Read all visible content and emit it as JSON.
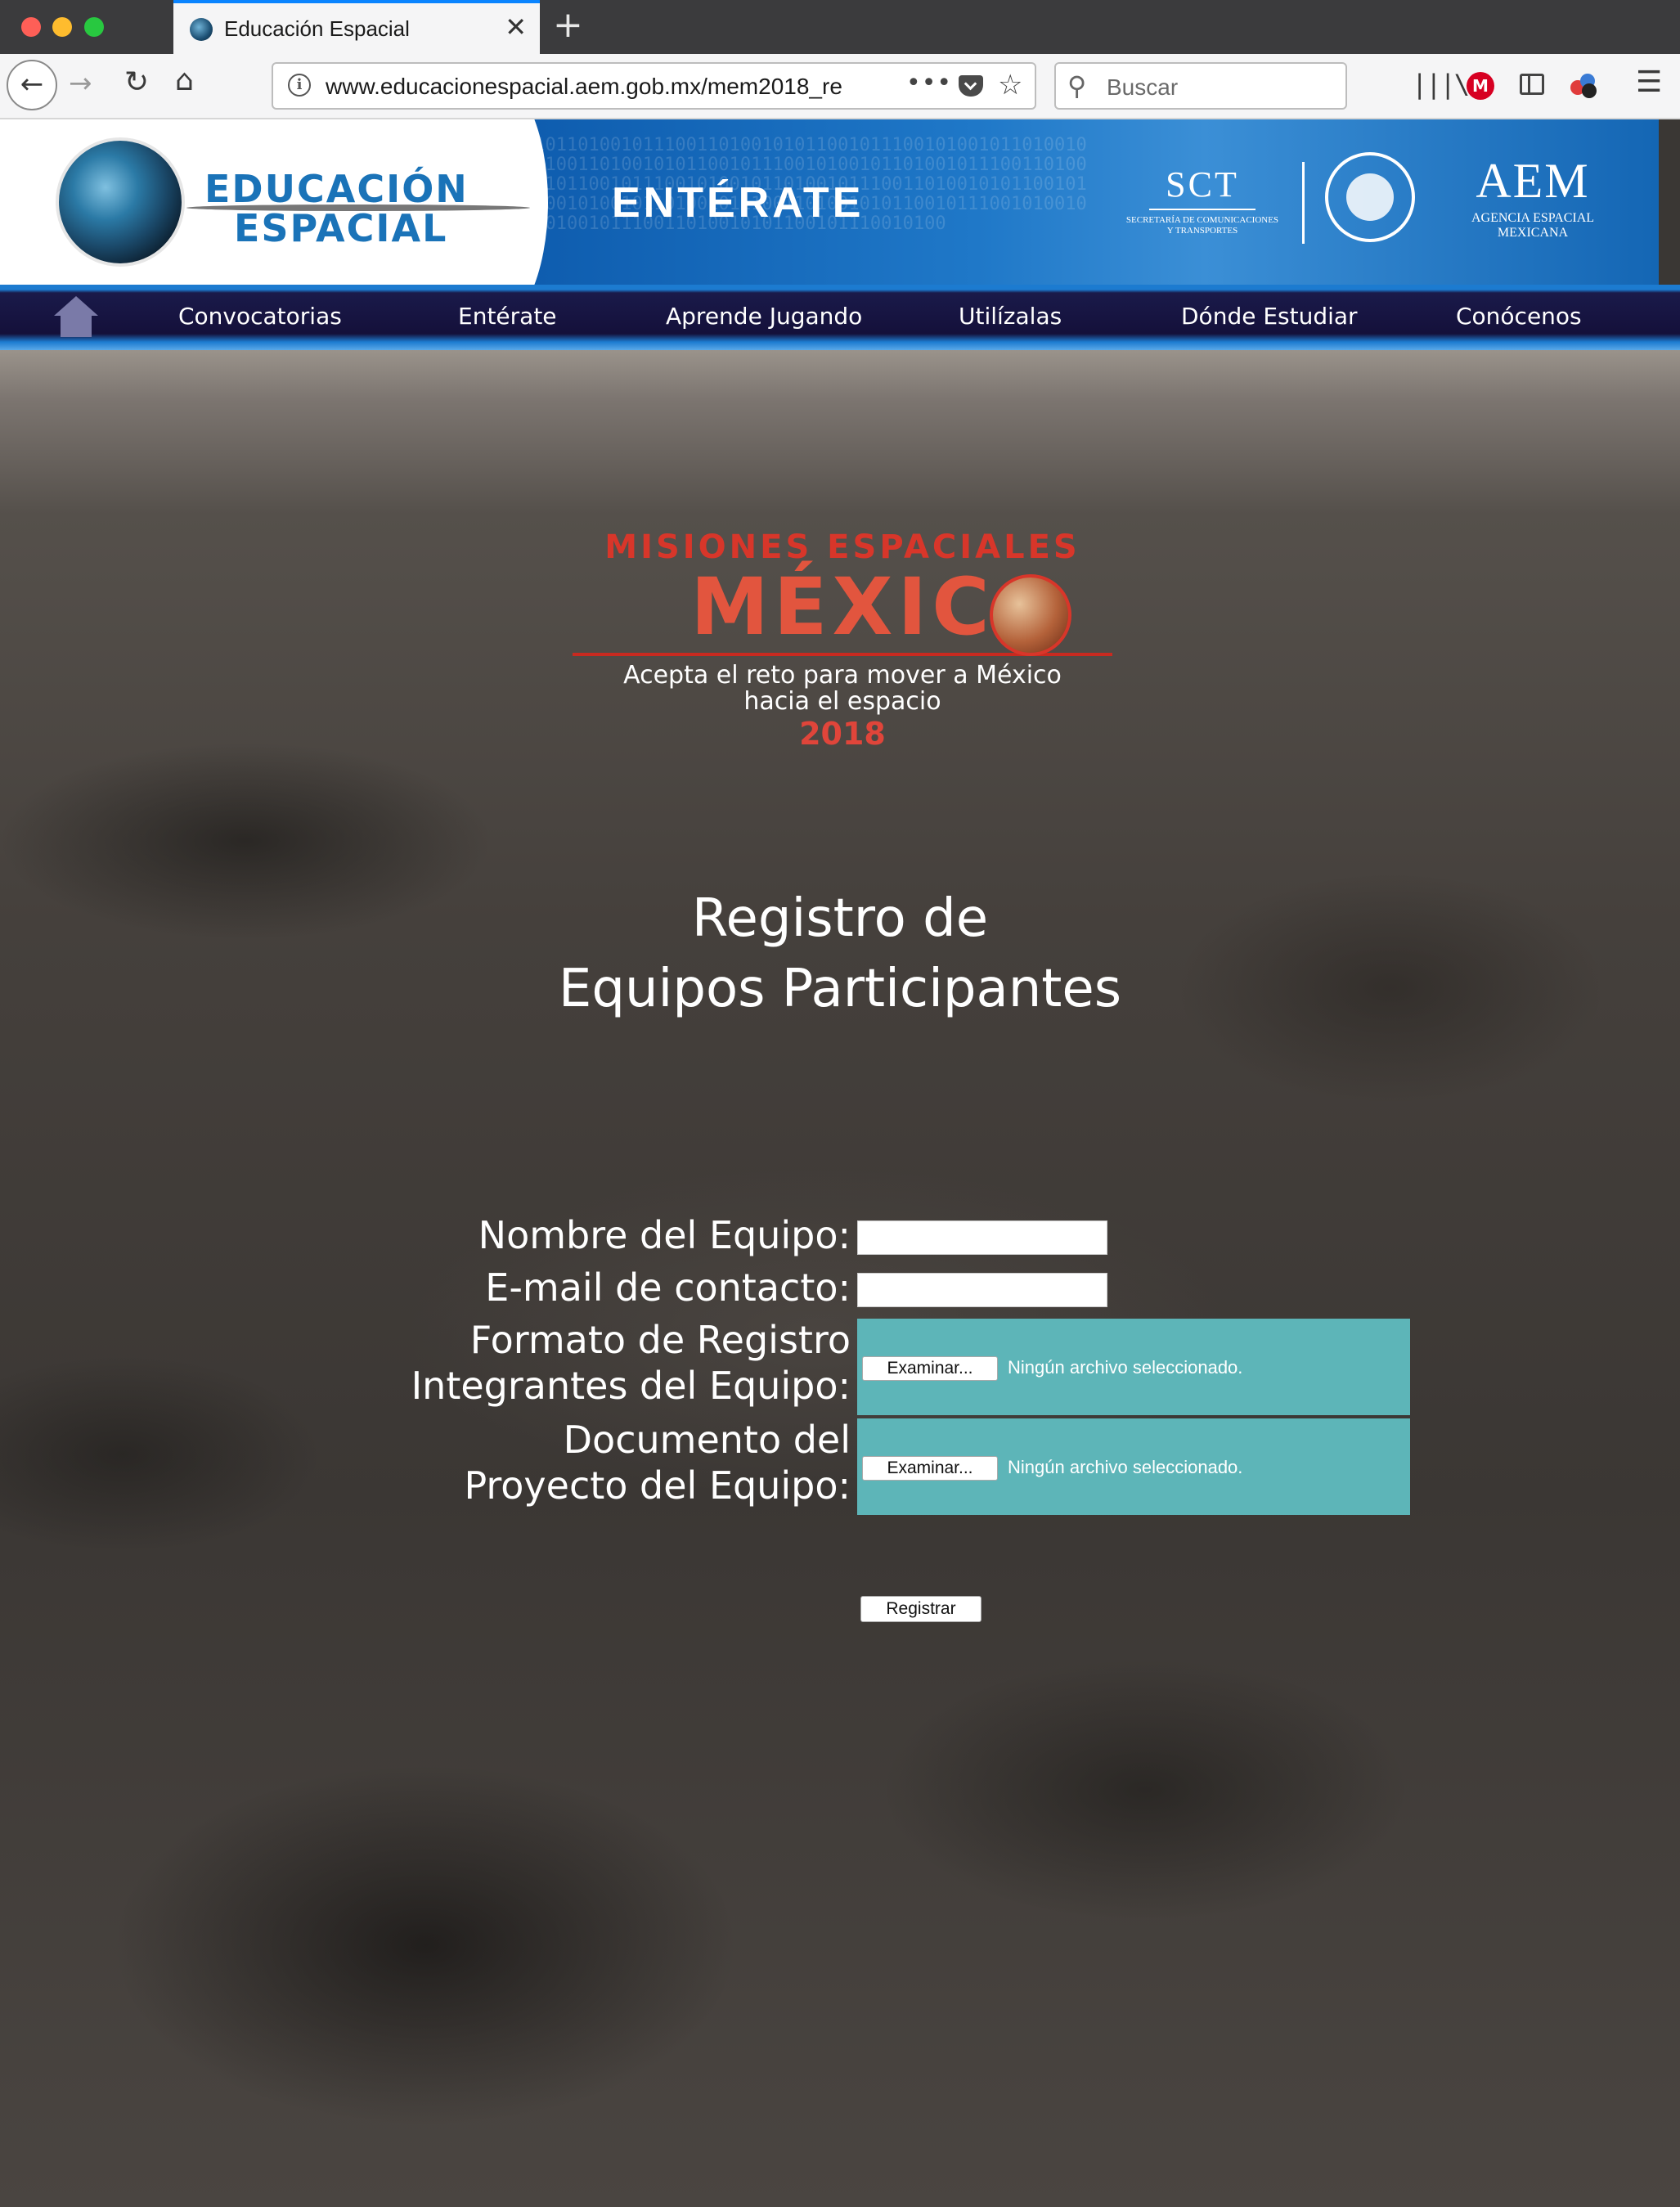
{
  "browser": {
    "tab_title": "Educación Espacial",
    "tab_close": "✕",
    "new_tab": "+",
    "url": "www.educacionespacial.aem.gob.mx/mem2018_re",
    "url_more": "•••",
    "search_placeholder": "Buscar",
    "icons": {
      "back": "←",
      "forward": "→",
      "reload": "↻",
      "home": "⌂",
      "star": "☆",
      "search": "⚲",
      "library": "|||\\",
      "menu": "☰",
      "ext_m": "M"
    }
  },
  "header": {
    "brand_line1": "EDUCACIÓN",
    "brand_line2": "ESPACIAL",
    "banner_title": "ENTÉRATE",
    "sct_big": "SCT",
    "sct_small": "SECRETARÍA DE COMUNICACIONES Y TRANSPORTES",
    "aem_big": "AEM",
    "aem_small": "AGENCIA ESPACIAL MEXICANA",
    "digits": "0101101001011100110100101011001011100101001011010010111001101001010110010111001010010110100101110011010010101100101110010100101101001011100110100101011001011100101001011010010111001101001010110010111001010010110100101110011010010101100101110010100"
  },
  "nav": {
    "items": [
      "Convocatorias",
      "Entérate",
      "Aprende Jugando",
      "Utilízalas",
      "Dónde Estudiar",
      "Conócenos"
    ]
  },
  "mission": {
    "top": "MISIONES ESPACIALES",
    "main": "MÉXIC",
    "tagline1": "Acepta el reto para mover a México",
    "tagline2": "hacia el espacio",
    "year": "2018"
  },
  "form": {
    "title_line1": "Registro de",
    "title_line2": "Equipos Participantes",
    "team_name_label": "Nombre del Equipo:",
    "team_name_value": "",
    "email_label": "E-mail de contacto:",
    "email_value": "",
    "format_label_line1": "Formato de Registro",
    "format_label_line2": "Integrantes del Equipo:",
    "project_label_line1": "Documento del",
    "project_label_line2": "Proyecto del Equipo:",
    "browse_label": "Examinar...",
    "no_file": "Ningún archivo seleccionado.",
    "submit_label": "Registrar"
  },
  "colors": {
    "file_box": "#5db5b8",
    "header_blue": "#1f78c8",
    "nav_dark": "#14103a",
    "mission_red": "#d8362a"
  }
}
